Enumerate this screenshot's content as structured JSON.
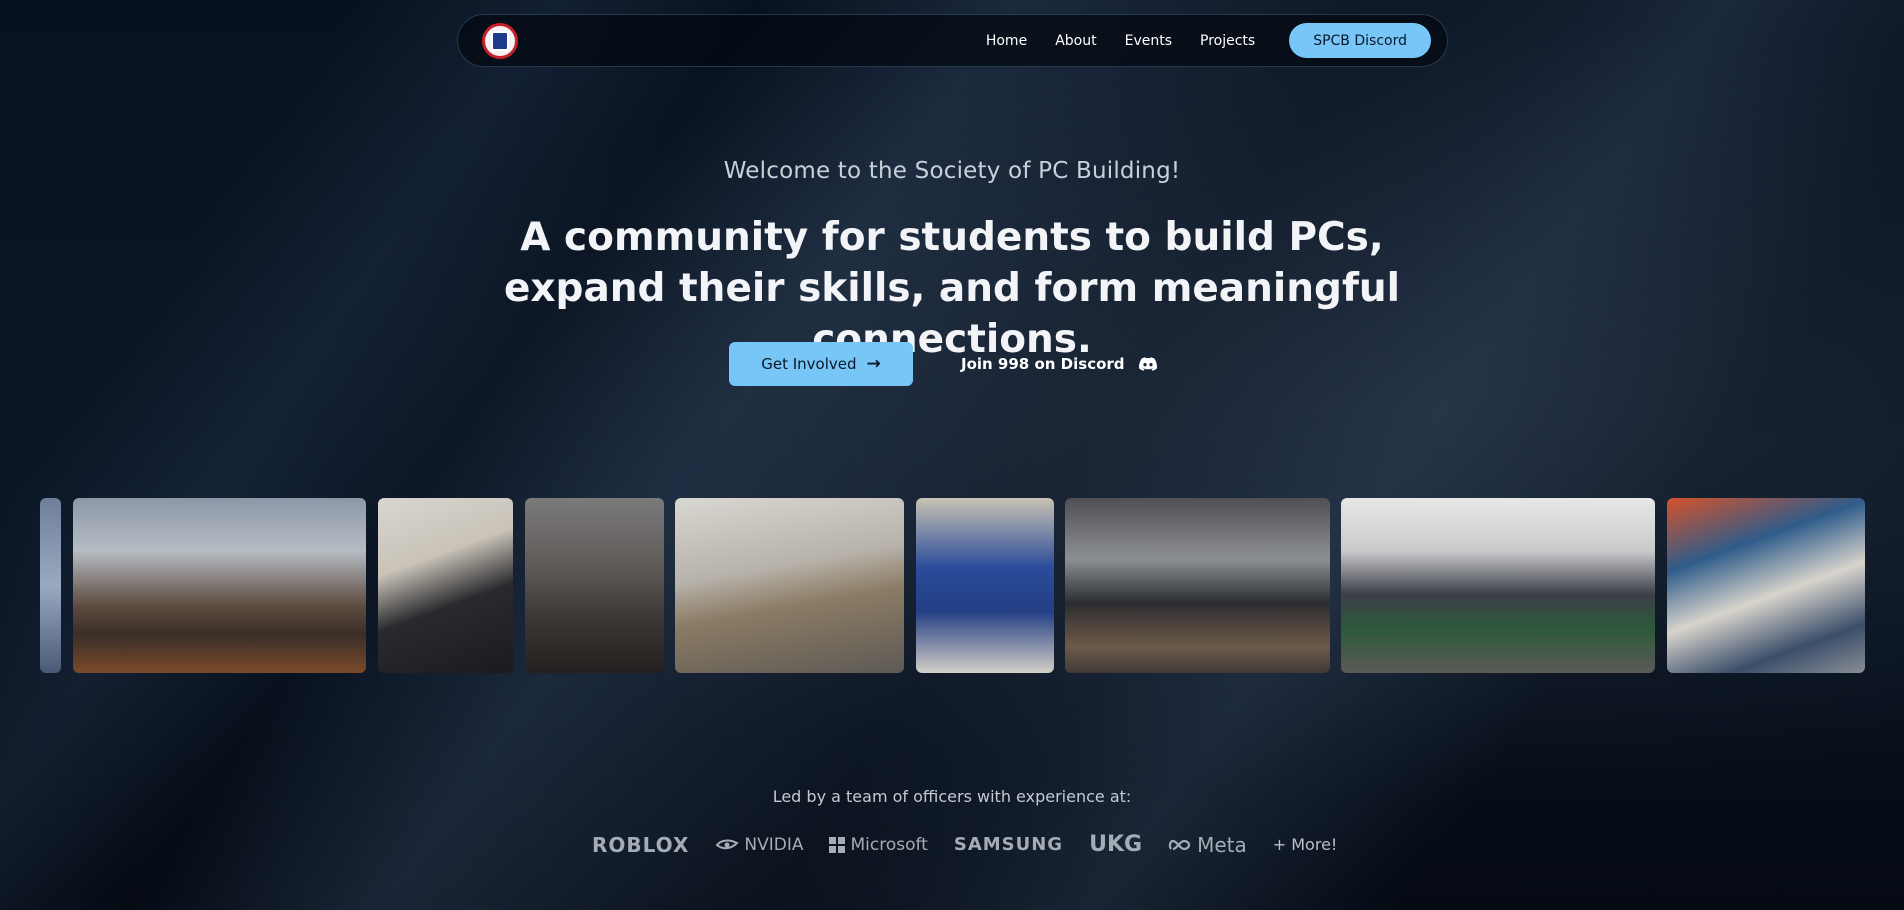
{
  "nav": {
    "logo_alt": "SPCB logo",
    "links": [
      "Home",
      "About",
      "Events",
      "Projects"
    ],
    "cta": "SPCB Discord"
  },
  "hero": {
    "subtitle": "Welcome to the Society of PC Building!",
    "title": "A community for students to build PCs, expand their skills, and form meaningful connections.",
    "primary_button": "Get Involved",
    "primary_icon": "arrow-right-icon",
    "secondary_button": "Join 998 on Discord",
    "secondary_icon": "discord-icon"
  },
  "gallery": {
    "photos": [
      "member-photo",
      "group-photo-with-pc-parts",
      "student-building-pc",
      "lecture-hall-audience",
      "student-holding-gpu",
      "students-at-qr-code",
      "racing-simulator",
      "event-with-pizza-boxes",
      "students-assembling-pc"
    ]
  },
  "sponsors": {
    "heading": "Led by a team of officers with experience at:",
    "logos": [
      "ROBLOX",
      "NVIDIA",
      "Microsoft",
      "SAMSUNG",
      "UKG",
      "Meta"
    ],
    "more": "+ More!"
  },
  "colors": {
    "accent": "#78c6f8",
    "background": "#060d18"
  }
}
